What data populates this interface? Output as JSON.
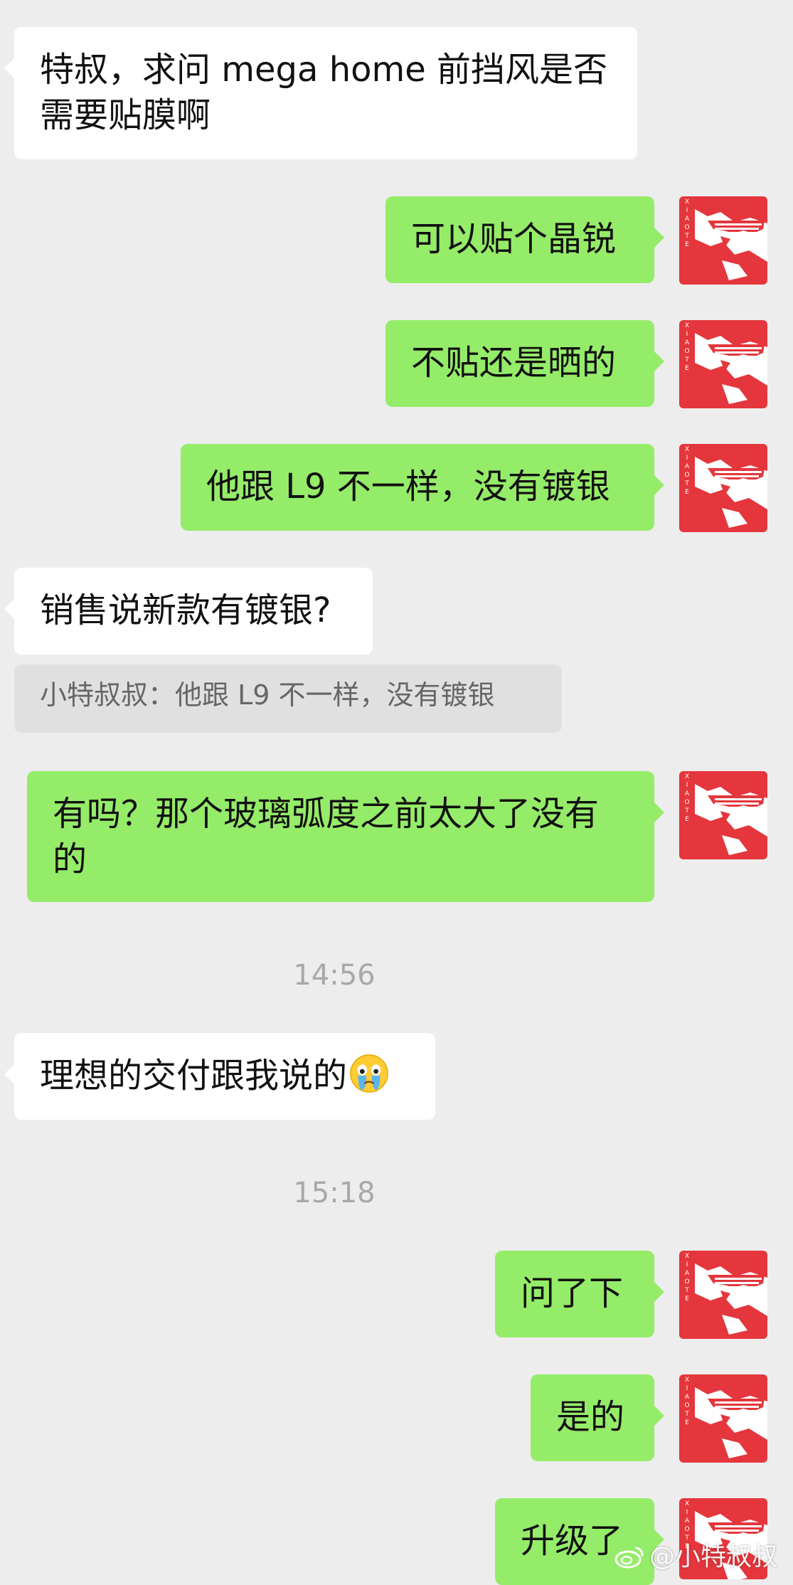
{
  "conversation": {
    "msg1": {
      "text": "特叔，求问 mega home 前挡风是否需要贴膜啊"
    },
    "msg2": {
      "text": "可以贴个晶锐"
    },
    "msg3": {
      "text": "不贴还是晒的"
    },
    "msg4": {
      "text": "他跟 L9 不一样，没有镀银"
    },
    "msg5": {
      "text": "销售说新款有镀银?"
    },
    "quote5": {
      "text": "小特叔叔：他跟 L9 不一样，没有镀银"
    },
    "msg6": {
      "text": "有吗？那个玻璃弧度之前太大了没有的"
    },
    "time1": {
      "text": "14:56"
    },
    "msg7": {
      "text": "理想的交付跟我说的",
      "emoji": "crying-emoji"
    },
    "time2": {
      "text": "15:18"
    },
    "msg8": {
      "text": "问了下"
    },
    "msg9": {
      "text": "是的"
    },
    "msg10": {
      "text": "升级了"
    }
  },
  "avatar": {
    "label": "XIAOTE",
    "icon": "xiaote-avatar-icon"
  },
  "watermark": {
    "text": "@小特叔叔",
    "icon": "weibo-logo-icon"
  },
  "colors": {
    "background": "#ededed",
    "incoming_bubble": "#ffffff",
    "outgoing_bubble": "#95ec69",
    "avatar_red": "#e4363c",
    "timestamp": "#a8a8a8"
  }
}
